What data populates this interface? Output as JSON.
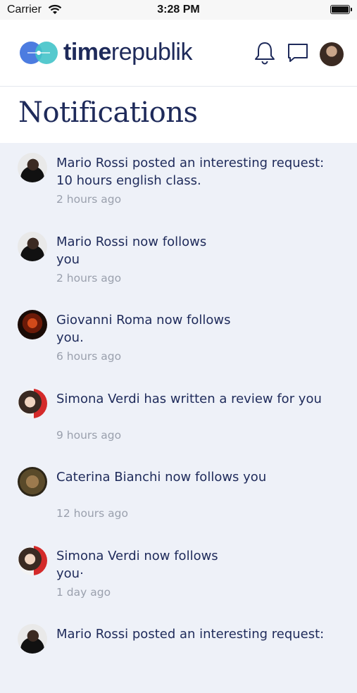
{
  "status_bar": {
    "carrier": "Carrier",
    "time": "3:28 PM"
  },
  "header": {
    "logo_bold": "time",
    "logo_regular": "republik",
    "icons": [
      "bell-icon",
      "chat-bubble-icon",
      "profile-avatar"
    ]
  },
  "page": {
    "title": "Notifications"
  },
  "colors": {
    "brand_navy": "#1e2a5a",
    "logo_blue": "#4c7ce0",
    "logo_teal": "#42c3c9",
    "list_bg": "#eef1f8",
    "muted_text": "#9aa0ad"
  },
  "notifications": [
    {
      "text": "Mario Rossi posted an interesting request: 10 hours english class.",
      "time": "2 hours ago"
    },
    {
      "text": "Mario Rossi now follows you",
      "time": "2 hours ago"
    },
    {
      "text": "Giovanni Roma now follows you.",
      "time": "6 hours ago"
    },
    {
      "text": "Simona Verdi has written a review for you",
      "time": "9 hours ago"
    },
    {
      "text": "Caterina Bianchi now follows you",
      "time": "12 hours ago"
    },
    {
      "text": "Simona Verdi now follows you·",
      "time": "1 day ago"
    },
    {
      "text": "Mario Rossi posted an interesting request:",
      "time": ""
    }
  ]
}
